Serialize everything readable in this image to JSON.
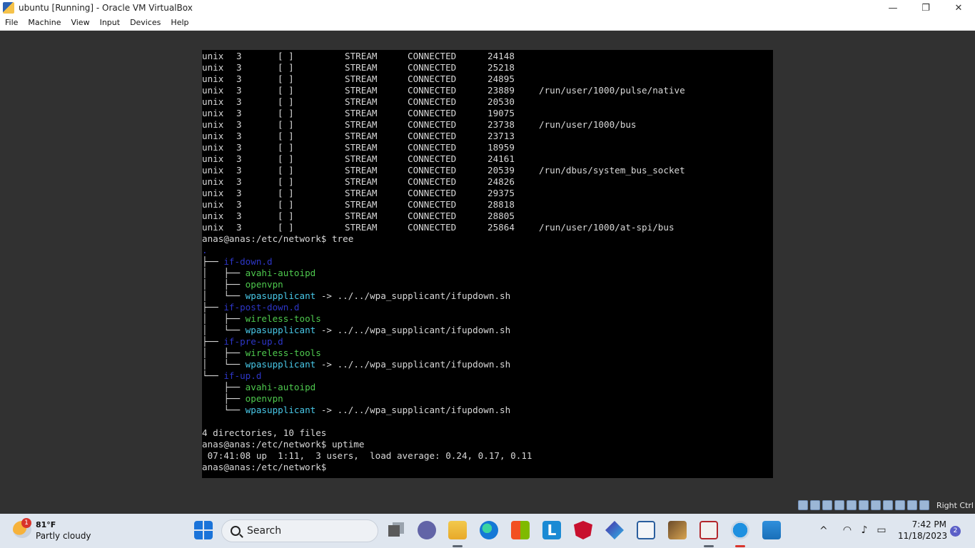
{
  "window": {
    "title": "ubuntu [Running] - Oracle VM VirtualBox",
    "minimize_glyph": "—",
    "restore_glyph": "❐",
    "close_glyph": "✕"
  },
  "menu": [
    "File",
    "Machine",
    "View",
    "Input",
    "Devices",
    "Help"
  ],
  "terminal": {
    "netstat_rows": [
      {
        "proto": "unix",
        "refcnt": "3",
        "flags": "[ ]",
        "type": "STREAM",
        "state": "CONNECTED",
        "inode": "24148",
        "path": ""
      },
      {
        "proto": "unix",
        "refcnt": "3",
        "flags": "[ ]",
        "type": "STREAM",
        "state": "CONNECTED",
        "inode": "25218",
        "path": ""
      },
      {
        "proto": "unix",
        "refcnt": "3",
        "flags": "[ ]",
        "type": "STREAM",
        "state": "CONNECTED",
        "inode": "24895",
        "path": ""
      },
      {
        "proto": "unix",
        "refcnt": "3",
        "flags": "[ ]",
        "type": "STREAM",
        "state": "CONNECTED",
        "inode": "23889",
        "path": "/run/user/1000/pulse/native"
      },
      {
        "proto": "unix",
        "refcnt": "3",
        "flags": "[ ]",
        "type": "STREAM",
        "state": "CONNECTED",
        "inode": "20530",
        "path": ""
      },
      {
        "proto": "unix",
        "refcnt": "3",
        "flags": "[ ]",
        "type": "STREAM",
        "state": "CONNECTED",
        "inode": "19075",
        "path": ""
      },
      {
        "proto": "unix",
        "refcnt": "3",
        "flags": "[ ]",
        "type": "STREAM",
        "state": "CONNECTED",
        "inode": "23738",
        "path": "/run/user/1000/bus"
      },
      {
        "proto": "unix",
        "refcnt": "3",
        "flags": "[ ]",
        "type": "STREAM",
        "state": "CONNECTED",
        "inode": "23713",
        "path": ""
      },
      {
        "proto": "unix",
        "refcnt": "3",
        "flags": "[ ]",
        "type": "STREAM",
        "state": "CONNECTED",
        "inode": "18959",
        "path": ""
      },
      {
        "proto": "unix",
        "refcnt": "3",
        "flags": "[ ]",
        "type": "STREAM",
        "state": "CONNECTED",
        "inode": "24161",
        "path": ""
      },
      {
        "proto": "unix",
        "refcnt": "3",
        "flags": "[ ]",
        "type": "STREAM",
        "state": "CONNECTED",
        "inode": "20539",
        "path": "/run/dbus/system_bus_socket"
      },
      {
        "proto": "unix",
        "refcnt": "3",
        "flags": "[ ]",
        "type": "STREAM",
        "state": "CONNECTED",
        "inode": "24826",
        "path": ""
      },
      {
        "proto": "unix",
        "refcnt": "3",
        "flags": "[ ]",
        "type": "STREAM",
        "state": "CONNECTED",
        "inode": "29375",
        "path": ""
      },
      {
        "proto": "unix",
        "refcnt": "3",
        "flags": "[ ]",
        "type": "STREAM",
        "state": "CONNECTED",
        "inode": "28818",
        "path": ""
      },
      {
        "proto": "unix",
        "refcnt": "3",
        "flags": "[ ]",
        "type": "STREAM",
        "state": "CONNECTED",
        "inode": "28805",
        "path": ""
      },
      {
        "proto": "unix",
        "refcnt": "3",
        "flags": "[ ]",
        "type": "STREAM",
        "state": "CONNECTED",
        "inode": "25864",
        "path": "/run/user/1000/at-spi/bus"
      }
    ],
    "prompt_tree": "anas@anas:/etc/network$ tree",
    "tree_root": ".",
    "tree": [
      {
        "prefix": "├── ",
        "name": "if-down.d",
        "kind": "dir"
      },
      {
        "prefix": "│   ├── ",
        "name": "avahi-autoipd",
        "kind": "exec"
      },
      {
        "prefix": "│   ├── ",
        "name": "openvpn",
        "kind": "exec"
      },
      {
        "prefix": "│   └── ",
        "name": "wpasupplicant",
        "kind": "link",
        "target": " -> ../../wpa_supplicant/ifupdown.sh"
      },
      {
        "prefix": "├── ",
        "name": "if-post-down.d",
        "kind": "dir"
      },
      {
        "prefix": "│   ├── ",
        "name": "wireless-tools",
        "kind": "exec"
      },
      {
        "prefix": "│   └── ",
        "name": "wpasupplicant",
        "kind": "link",
        "target": " -> ../../wpa_supplicant/ifupdown.sh"
      },
      {
        "prefix": "├── ",
        "name": "if-pre-up.d",
        "kind": "dir"
      },
      {
        "prefix": "│   ├── ",
        "name": "wireless-tools",
        "kind": "exec"
      },
      {
        "prefix": "│   └── ",
        "name": "wpasupplicant",
        "kind": "link",
        "target": " -> ../../wpa_supplicant/ifupdown.sh"
      },
      {
        "prefix": "└── ",
        "name": "if-up.d",
        "kind": "dir"
      },
      {
        "prefix": "    ├── ",
        "name": "avahi-autoipd",
        "kind": "exec"
      },
      {
        "prefix": "    ├── ",
        "name": "openvpn",
        "kind": "exec"
      },
      {
        "prefix": "    └── ",
        "name": "wpasupplicant",
        "kind": "link",
        "target": " -> ../../wpa_supplicant/ifupdown.sh"
      }
    ],
    "tree_summary": "4 directories, 10 files",
    "prompt_uptime": "anas@anas:/etc/network$ uptime",
    "uptime_output": " 07:41:08 up  1:11,  3 users,  load average: 0.24, 0.17, 0.11",
    "prompt_final": "anas@anas:/etc/network$ "
  },
  "statusbar": {
    "host_key_label": "Right Ctrl"
  },
  "taskbar": {
    "weather_temp": "81°F",
    "weather_desc": "Partly cloudy",
    "weather_badge": "1",
    "search_placeholder": "Search",
    "time": "7:42 PM",
    "date": "11/18/2023",
    "notification_count": "2"
  }
}
